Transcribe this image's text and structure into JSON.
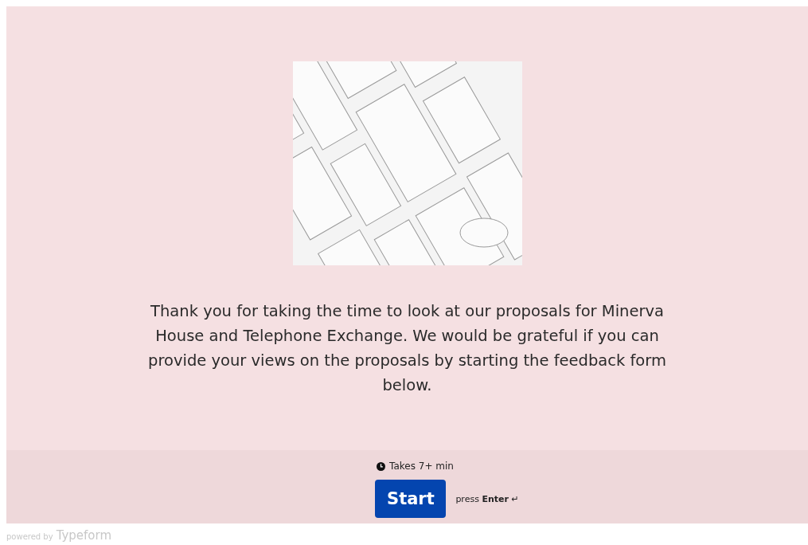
{
  "welcome": {
    "message": "Thank you for taking the time to look at our proposals for Minerva House and Telephone Exchange. We would be grateful if you can provide your views on the proposals by starting the feedback form below."
  },
  "footer": {
    "time_estimate": "Takes 7+ min",
    "start_button": "Start",
    "hint": "press **Enter**",
    "enter_symbol": "↵"
  },
  "branding": {
    "powered_by": "powered by",
    "brand": "Typeform"
  }
}
